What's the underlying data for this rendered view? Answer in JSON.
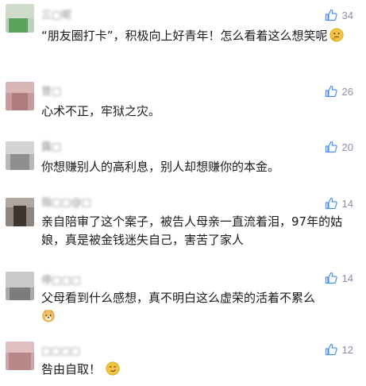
{
  "comments": [
    {
      "username": "三□呢",
      "text": "“朋友圈打卡”，积极向上好青年！怎么看着这么想笑呢",
      "emoji": "thinking-face-emoji",
      "likes": "34"
    },
    {
      "username": "昔□",
      "text": "心术不正，牢狱之灾。",
      "likes": "26"
    },
    {
      "username": "露□",
      "text": "你想赚别人的高利息，别人却想赚你的本金。",
      "likes": "20"
    },
    {
      "username": "指□□@□",
      "text": "亲自陪审了这个案子，被告人母亲一直流着泪，97年的姑娘，真是被金钱迷失自己，害苦了家人",
      "likes": "14"
    },
    {
      "username": "停□□□",
      "text": "父母看到什么感想，真不明白这么虚荣的活着不累么",
      "emoji": "dog-face-emoji",
      "likes": "14"
    },
    {
      "username": "□□□□",
      "text": "咎由自取！",
      "emoji": "smirk-face-emoji",
      "likes": "12"
    }
  ],
  "colors": {
    "like_icon": "#4a8ff0",
    "like_count": "#8a8fa3",
    "text": "#1a1a1a",
    "username": "#8a8a8a"
  }
}
